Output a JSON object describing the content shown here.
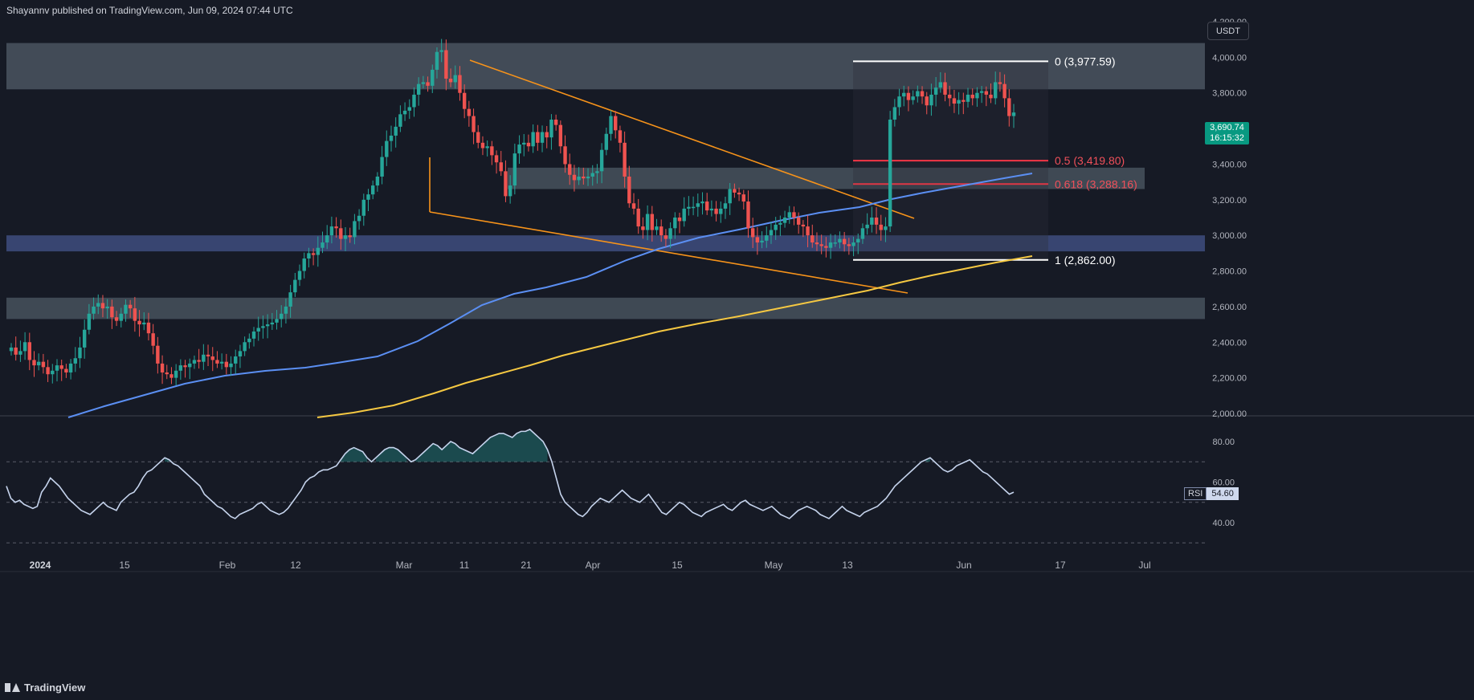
{
  "header": {
    "publisher": "Shayannv published on TradingView.com, Jun 09, 2024 07:44 UTC"
  },
  "footer": {
    "brand": "TradingView"
  },
  "price_axis": {
    "unit": "USDT",
    "last_price": "3,690.74",
    "countdown": "16:15:32"
  },
  "rsi": {
    "label": "RSI",
    "value": "54.60"
  },
  "colors": {
    "background": "#161a25",
    "up": "#26a69a",
    "down": "#ef5350",
    "ema_blue": "#5b8ff3",
    "ema_yellow": "#f5c842",
    "wedge": "#f7931a",
    "zone_gray": "#4a5560",
    "zone_blue": "#3c4a7a",
    "rsi_line": "#c5d3ec"
  },
  "chart_data": [
    {
      "type": "candlestick",
      "title": "",
      "y_axis": {
        "min": 2000,
        "max": 4200,
        "ticks": [
          "2,000.00",
          "2,200.00",
          "2,400.00",
          "2,600.00",
          "2,800.00",
          "3,000.00",
          "3,200.00",
          "3,400.00",
          "3,600.00",
          "3,800.00",
          "4,000.00",
          "4,200.00"
        ]
      },
      "x_axis": {
        "labels": [
          "2024",
          "15",
          "Feb",
          "12",
          "Mar",
          "11",
          "21",
          "Apr",
          "15",
          "May",
          "13",
          "Jun",
          "17",
          "Jul"
        ]
      },
      "zones": [
        {
          "kind": "resistance",
          "from": 3820,
          "to": 4080
        },
        {
          "kind": "support",
          "from": 3260,
          "to": 3380
        },
        {
          "kind": "support-blue",
          "from": 2910,
          "to": 3000
        },
        {
          "kind": "support",
          "from": 2530,
          "to": 2650
        }
      ],
      "fibonacci": [
        {
          "label": "0 (3,977.59)",
          "price": 3977.59
        },
        {
          "label": "0.5 (3,419.80)",
          "price": 3419.8
        },
        {
          "label": "0.618 (3,288.16)",
          "price": 3288.16
        },
        {
          "label": "1 (2,862.00)",
          "price": 2862.0
        }
      ],
      "closes": [
        2370,
        2330,
        2350,
        2400,
        2300,
        2270,
        2290,
        2260,
        2220,
        2240,
        2270,
        2250,
        2230,
        2280,
        2310,
        2370,
        2470,
        2560,
        2600,
        2620,
        2590,
        2600,
        2540,
        2520,
        2560,
        2610,
        2590,
        2520,
        2500,
        2510,
        2450,
        2380,
        2280,
        2230,
        2220,
        2200,
        2240,
        2270,
        2260,
        2280,
        2300,
        2290,
        2330,
        2320,
        2300,
        2280,
        2290,
        2260,
        2280,
        2320,
        2350,
        2400,
        2420,
        2460,
        2480,
        2490,
        2500,
        2510,
        2530,
        2560,
        2600,
        2680,
        2750,
        2800,
        2870,
        2900,
        2890,
        2930,
        2960,
        3000,
        3050,
        3040,
        2980,
        3000,
        2990,
        3080,
        3110,
        3200,
        3230,
        3280,
        3330,
        3440,
        3530,
        3560,
        3610,
        3680,
        3700,
        3720,
        3790,
        3850,
        3860,
        3840,
        3930,
        4030,
        4040,
        3880,
        3860,
        3900,
        3800,
        3710,
        3670,
        3580,
        3520,
        3490,
        3500,
        3450,
        3410,
        3360,
        3220,
        3280,
        3460,
        3510,
        3520,
        3500,
        3580,
        3520,
        3580,
        3550,
        3650,
        3620,
        3500,
        3400,
        3340,
        3310,
        3330,
        3320,
        3330,
        3350,
        3360,
        3480,
        3570,
        3670,
        3590,
        3520,
        3330,
        3180,
        3150,
        3050,
        3030,
        3120,
        3030,
        3050,
        3000,
        2980,
        3040,
        3100,
        3080,
        3150,
        3160,
        3160,
        3180,
        3190,
        3140,
        3150,
        3120,
        3150,
        3180,
        3260,
        3240,
        3230,
        3190,
        3040,
        2990,
        2960,
        2970,
        3000,
        3030,
        3060,
        3070,
        3100,
        3130,
        3100,
        3060,
        3050,
        3000,
        2960,
        2950,
        2940,
        2930,
        2960,
        2960,
        2980,
        2950,
        2940,
        2960,
        2980,
        3040,
        3060,
        3100,
        3060,
        3030,
        3050,
        3650,
        3720,
        3780,
        3800,
        3760,
        3780,
        3810,
        3780,
        3730,
        3790,
        3830,
        3860,
        3790,
        3770,
        3740,
        3760,
        3750,
        3790,
        3770,
        3800,
        3810,
        3790,
        3770,
        3860,
        3850,
        3770,
        3670,
        3690
      ],
      "ema_fast": [
        [
          85,
          520
        ],
        [
          130,
          506
        ],
        [
          180,
          492
        ],
        [
          230,
          478
        ],
        [
          280,
          468
        ],
        [
          330,
          462
        ],
        [
          380,
          458
        ],
        [
          420,
          452
        ],
        [
          470,
          444
        ],
        [
          520,
          425
        ],
        [
          560,
          403
        ],
        [
          600,
          380
        ],
        [
          640,
          366
        ],
        [
          680,
          358
        ],
        [
          730,
          345
        ],
        [
          780,
          324
        ],
        [
          820,
          310
        ],
        [
          870,
          296
        ],
        [
          920,
          286
        ],
        [
          970,
          275
        ],
        [
          1020,
          265
        ],
        [
          1070,
          258
        ],
        [
          1110,
          248
        ],
        [
          1150,
          240
        ],
        [
          1200,
          231
        ],
        [
          1250,
          222
        ],
        [
          1285,
          216
        ]
      ],
      "ema_slow": [
        [
          395,
          520
        ],
        [
          440,
          514
        ],
        [
          490,
          505
        ],
        [
          540,
          490
        ],
        [
          580,
          477
        ],
        [
          620,
          466
        ],
        [
          660,
          455
        ],
        [
          700,
          443
        ],
        [
          760,
          428
        ],
        [
          820,
          413
        ],
        [
          870,
          403
        ],
        [
          920,
          394
        ],
        [
          980,
          382
        ],
        [
          1030,
          372
        ],
        [
          1080,
          362
        ],
        [
          1120,
          352
        ],
        [
          1160,
          343
        ],
        [
          1200,
          335
        ],
        [
          1240,
          327
        ],
        [
          1285,
          319
        ]
      ],
      "wedge": {
        "upper": [
          [
            585,
            75
          ],
          [
            1138,
            272
          ]
        ],
        "lower": [
          [
            535,
            264
          ],
          [
            1130,
            365
          ]
        ],
        "left_edge": [
          [
            535,
            264
          ],
          [
            535,
            196
          ]
        ]
      }
    },
    {
      "type": "line",
      "title": "",
      "y_axis": {
        "ticks": [
          "80.00",
          "60.00",
          "40.00"
        ],
        "levels": [
          70,
          50,
          30
        ]
      },
      "values": [
        58,
        52,
        50,
        51,
        49,
        48,
        47,
        48,
        55,
        58,
        62,
        60,
        58,
        55,
        52,
        50,
        48,
        46,
        45,
        44,
        46,
        48,
        50,
        48,
        47,
        46,
        50,
        52,
        54,
        55,
        58,
        62,
        65,
        66,
        68,
        70,
        72,
        71,
        69,
        68,
        66,
        64,
        62,
        60,
        58,
        54,
        52,
        50,
        48,
        47,
        45,
        43,
        42,
        44,
        45,
        46,
        47,
        49,
        50,
        48,
        46,
        45,
        44,
        45,
        47,
        50,
        53,
        56,
        60,
        62,
        63,
        65,
        66,
        66,
        67,
        68,
        71,
        74,
        76,
        77,
        76,
        75,
        72,
        70,
        72,
        74,
        76,
        77,
        77,
        76,
        74,
        72,
        70,
        71,
        73,
        75,
        77,
        79,
        78,
        76,
        78,
        80,
        79,
        77,
        76,
        75,
        74,
        76,
        78,
        80,
        82,
        83,
        84,
        84,
        83,
        82,
        84,
        85,
        85,
        86,
        84,
        82,
        80,
        76,
        70,
        62,
        54,
        50,
        48,
        46,
        44,
        43,
        45,
        48,
        50,
        52,
        51,
        50,
        52,
        54,
        56,
        54,
        52,
        51,
        50,
        52,
        54,
        51,
        48,
        45,
        44,
        46,
        48,
        50,
        49,
        47,
        45,
        44,
        43,
        45,
        46,
        47,
        48,
        49,
        47,
        46,
        48,
        50,
        51,
        49,
        48,
        47,
        46,
        47,
        48,
        46,
        44,
        43,
        42,
        44,
        46,
        47,
        48,
        47,
        46,
        44,
        43,
        42,
        44,
        46,
        48,
        46,
        45,
        44,
        43,
        45,
        46,
        47,
        48,
        50,
        52,
        55,
        58,
        60,
        62,
        64,
        66,
        68,
        70,
        71,
        72,
        70,
        68,
        66,
        65,
        66,
        68,
        69,
        70,
        71,
        69,
        67,
        65,
        64,
        62,
        60,
        58,
        56,
        54,
        55
      ],
      "label": "RSI"
    }
  ]
}
